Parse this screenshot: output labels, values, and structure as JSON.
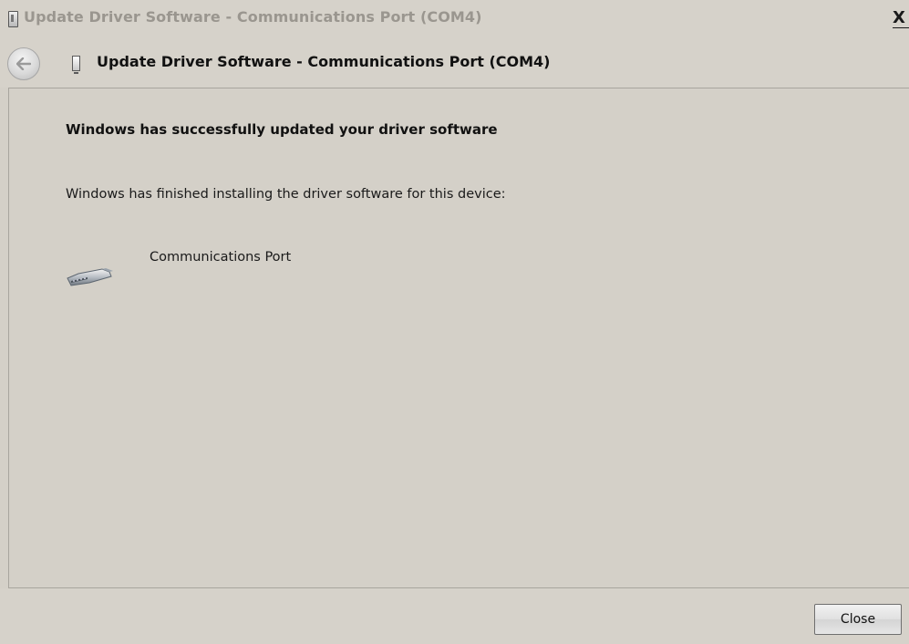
{
  "window": {
    "title": "Update Driver Software - Communications Port (COM4)",
    "close_glyph": "X"
  },
  "header": {
    "title": "Update Driver Software - Communications Port (COM4)",
    "back_icon": "back-arrow-icon",
    "device_icon": "usb-device-icon"
  },
  "content": {
    "heading": "Windows has successfully updated your driver software",
    "message": "Windows has finished installing the driver software for this device:",
    "device_name": "Communications Port",
    "device_icon": "serial-port-icon"
  },
  "footer": {
    "close_label": "Close"
  },
  "colors": {
    "window_bg": "#d4d0c8",
    "title_text_inactive": "#9a968f",
    "text": "#111111"
  }
}
